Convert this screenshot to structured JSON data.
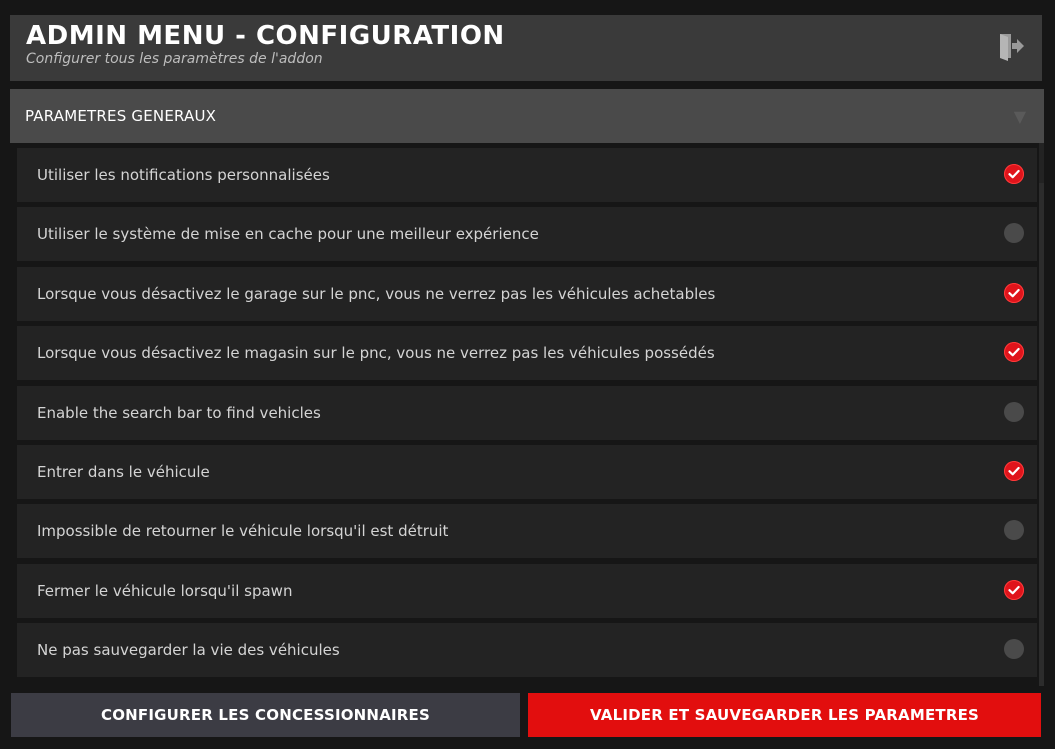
{
  "header": {
    "title": "ADMIN MENU - CONFIGURATION",
    "subtitle": "Configurer tous les paramètres de l'addon",
    "exit_icon": "exit-door-icon"
  },
  "section": {
    "label": "PARAMETRES GENERAUX",
    "chevron_icon": "chevron-down-icon"
  },
  "settings": [
    {
      "label": "Utiliser les notifications personnalisées",
      "enabled": true
    },
    {
      "label": "Utiliser le système de mise en cache pour une meilleur expérience",
      "enabled": false
    },
    {
      "label": "Lorsque vous désactivez le garage sur le pnc, vous ne verrez pas les véhicules achetables",
      "enabled": true
    },
    {
      "label": "Lorsque vous désactivez le magasin sur le pnc, vous ne verrez pas les véhicules possédés",
      "enabled": true
    },
    {
      "label": "Enable the search bar to find vehicles",
      "enabled": false
    },
    {
      "label": "Entrer dans le véhicule",
      "enabled": true
    },
    {
      "label": "Impossible de retourner le véhicule lorsqu'il est détruit",
      "enabled": false
    },
    {
      "label": "Fermer le véhicule lorsqu'il spawn",
      "enabled": true
    },
    {
      "label": "Ne pas sauvegarder la vie des véhicules",
      "enabled": false
    }
  ],
  "footer": {
    "configure_label": "CONFIGURER LES CONCESSIONNAIRES",
    "save_label": "VALIDER ET SAUVEGARDER LES PARAMETRES"
  },
  "colors": {
    "accent_red": "#e20e0e",
    "toggle_off": "#4a4a4a",
    "background": "#161616"
  }
}
